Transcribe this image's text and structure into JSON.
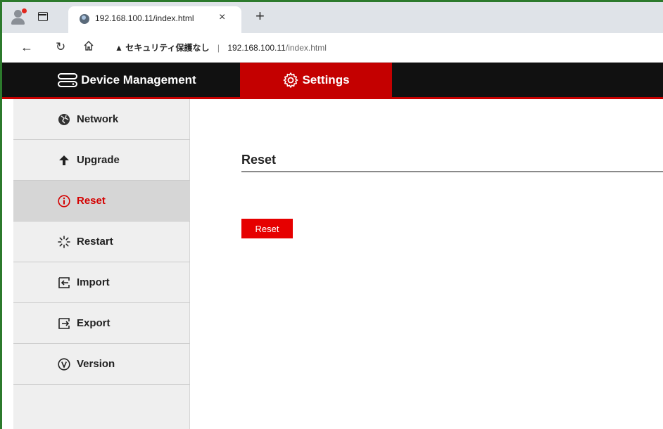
{
  "browser": {
    "tab_title": "192.168.100.11/index.html",
    "tab_close": "×",
    "new_tab": "+",
    "security_label": "セキュリティ保護なし",
    "address_host": "192.168.100.11",
    "address_path": "/index.html",
    "separator": "|"
  },
  "header": {
    "device_management": "Device Management",
    "settings": "Settings"
  },
  "sidebar": {
    "items": [
      {
        "label": "Network",
        "icon": "globe-icon"
      },
      {
        "label": "Upgrade",
        "icon": "arrow-up-icon"
      },
      {
        "label": "Reset",
        "icon": "info-circle-icon",
        "active": true
      },
      {
        "label": "Restart",
        "icon": "spinner-icon"
      },
      {
        "label": "Import",
        "icon": "import-icon"
      },
      {
        "label": "Export",
        "icon": "export-icon"
      },
      {
        "label": "Version",
        "icon": "version-icon"
      }
    ]
  },
  "main": {
    "title": "Reset",
    "button_label": "Reset"
  },
  "colors": {
    "accent": "#c40000",
    "button": "#e60000",
    "header_bg": "#111111",
    "sidebar_bg": "#efefef"
  }
}
